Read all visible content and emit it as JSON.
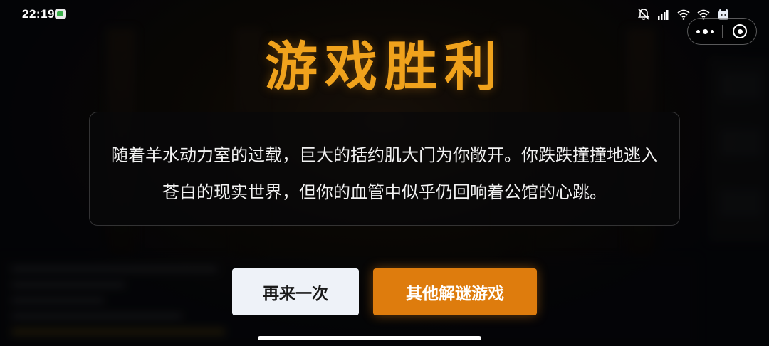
{
  "status_bar": {
    "time": "22:19",
    "icons": [
      "app-notification-icon",
      "mute-bell-icon",
      "hd-signal-icon",
      "wifi-icon",
      "wifi-icon",
      "battery-cat-icon"
    ]
  },
  "capsule": {
    "more_icon": "more-dots-icon",
    "close_icon": "mini-program-close-icon"
  },
  "dialog": {
    "title": "游戏胜利",
    "story": "随着羊水动力室的过载，巨大的括约肌大门为你敞开。你跌跌撞撞地逃入苍白的现实世界，但你的血管中似乎仍回响着公馆的心跳。",
    "buttons": {
      "restart_label": "再来一次",
      "other_label": "其他解谜游戏"
    }
  },
  "colors": {
    "title": "#f0a21c",
    "primary_button": "#de7c0d",
    "secondary_button": "#eef2f8",
    "background": "#07080c"
  }
}
